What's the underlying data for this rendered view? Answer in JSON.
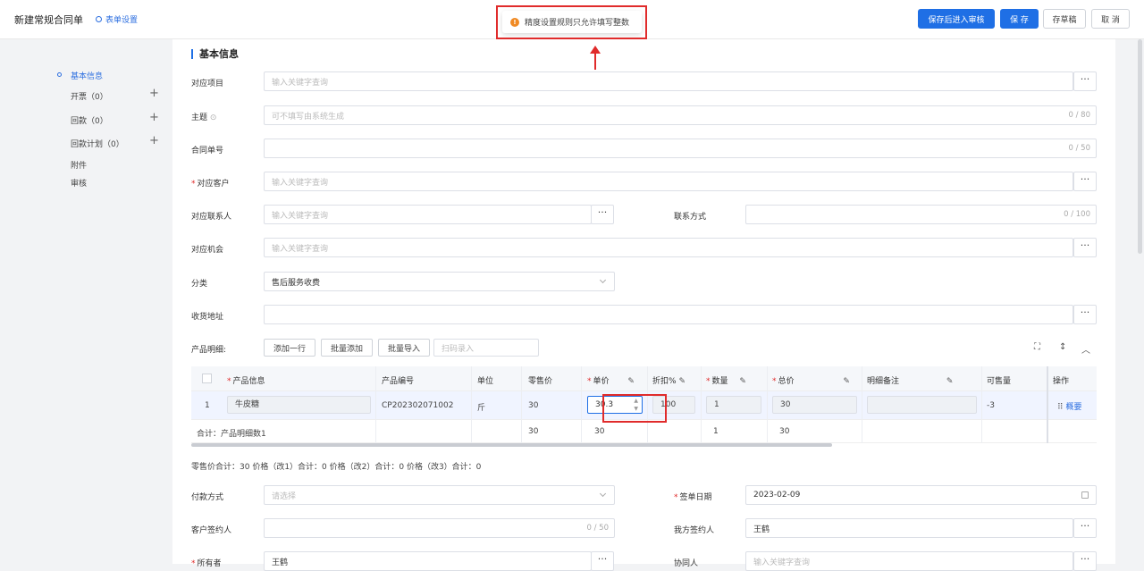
{
  "header": {
    "title": "新建常规合同单",
    "form_settings": "表单设置",
    "btn_save_review": "保存后进入审核",
    "btn_save": "保 存",
    "btn_draft": "存草稿",
    "btn_cancel": "取 消"
  },
  "toast": {
    "message": "精度设置规则只允许填写整数",
    "icon": "!"
  },
  "sidebar": {
    "items": [
      {
        "label": "基本信息"
      },
      {
        "label": "开票（0）"
      },
      {
        "label": "回款（0）"
      },
      {
        "label": "回款计划（0）"
      },
      {
        "label": "附件"
      },
      {
        "label": "审核"
      }
    ]
  },
  "section": {
    "title": "基本信息"
  },
  "fields": {
    "project": {
      "label": "对应项目",
      "placeholder": "输入关键字查询"
    },
    "subject": {
      "label": "主题",
      "placeholder": "可不填写由系统生成",
      "counter": "0 / 80"
    },
    "contract_no": {
      "label": "合同单号",
      "counter": "0 / 50"
    },
    "customer": {
      "label": "对应客户",
      "placeholder": "输入关键字查询"
    },
    "contact": {
      "label": "对应联系人",
      "placeholder": "输入关键字查询"
    },
    "contact_method": {
      "label": "联系方式",
      "counter": "0 / 100"
    },
    "opportunity": {
      "label": "对应机会",
      "placeholder": "输入关键字查询"
    },
    "category": {
      "label": "分类",
      "value": "售后服务收费"
    },
    "address": {
      "label": "收货地址"
    },
    "payment": {
      "label": "付款方式",
      "placeholder": "请选择"
    },
    "sign_date": {
      "label": "签单日期",
      "value": "2023-02-09"
    },
    "customer_signer": {
      "label": "客户签约人",
      "counter": "0 / 50"
    },
    "our_signer": {
      "label": "我方签约人",
      "value": "王鹤"
    },
    "owner": {
      "label": "所有者",
      "value": "王鹤"
    },
    "collaborator": {
      "label": "协同人",
      "placeholder": "输入关键字查询"
    }
  },
  "products": {
    "label": "产品明细:",
    "btn_add_row": "添加一行",
    "btn_batch_add": "批量添加",
    "btn_batch_import": "批量导入",
    "scan_placeholder": "扫码录入",
    "columns": [
      "产品信息",
      "产品编号",
      "单位",
      "零售价",
      "单价",
      "折扣%",
      "数量",
      "总价",
      "明细备注",
      "可售量",
      "操作"
    ],
    "row": {
      "index": "1",
      "name": "牛皮糖",
      "code": "CP202302071002",
      "unit": "斤",
      "retail": "30",
      "price": "30.3",
      "discount": "100",
      "qty": "1",
      "total": "30",
      "remark": "",
      "stock": "-3",
      "action": "概要"
    },
    "totals": {
      "label": "合计：产品明细数1",
      "retail": "30",
      "price": "30",
      "qty": "1",
      "total": "30"
    },
    "summary": "零售价合计：30  价格（改1）合计：0  价格（改2）合计：0  价格（改3）合计：0"
  }
}
